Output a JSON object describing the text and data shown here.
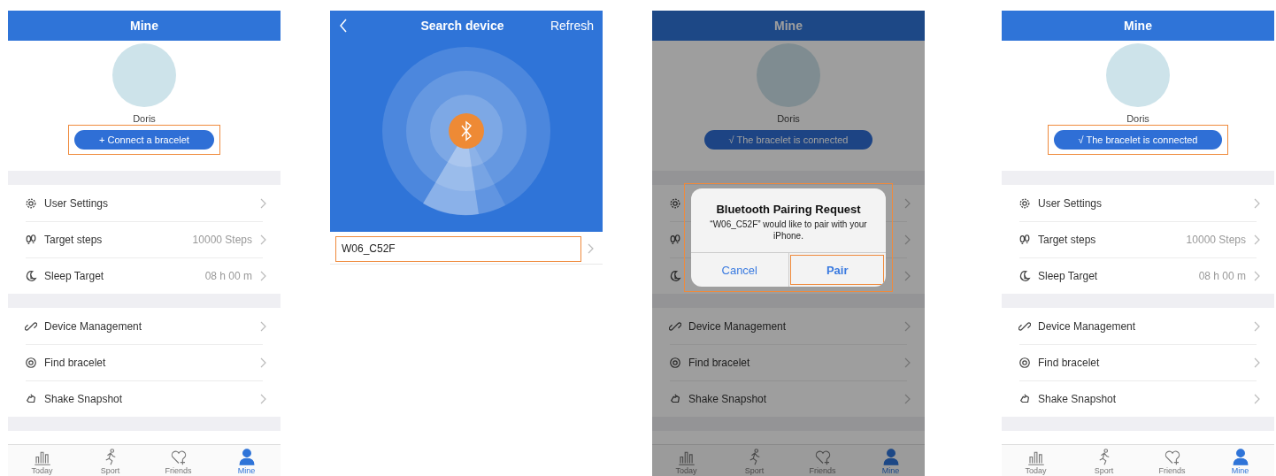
{
  "panels": [
    {
      "kind": "profile",
      "title": "Mine",
      "user_name": "Doris",
      "bracelet_button": {
        "label": "+ Connect a bracelet",
        "highlighted": true
      },
      "groups": [
        [
          {
            "kind": "setting",
            "label": "User Settings"
          },
          {
            "kind": "setting",
            "label": "Target steps",
            "value": "10000 Steps"
          },
          {
            "kind": "setting",
            "label": "Sleep Target",
            "value": "08 h 00 m"
          }
        ],
        [
          {
            "kind": "setting",
            "label": "Device Management"
          },
          {
            "kind": "setting",
            "label": "Find bracelet"
          },
          {
            "kind": "setting",
            "label": "Shake Snapshot"
          }
        ]
      ],
      "tabs": [
        {
          "label": "Today",
          "selected": false
        },
        {
          "label": "Sport",
          "selected": false
        },
        {
          "label": "Friends",
          "selected": false
        },
        {
          "label": "Mine",
          "selected": true
        }
      ]
    },
    {
      "kind": "search",
      "title": "Search device",
      "action": "Refresh",
      "devices": [
        {
          "name": "W06_C52F",
          "highlighted": true
        }
      ]
    },
    {
      "kind": "profile",
      "title": "Mine",
      "user_name": "Doris",
      "bracelet_button": {
        "label": "√ The bracelet is connected",
        "highlighted": false
      },
      "groups": [
        [
          {
            "kind": "covered"
          },
          {
            "kind": "covered"
          },
          {
            "kind": "covered"
          }
        ],
        [
          {
            "kind": "setting",
            "label": "Device Management"
          },
          {
            "kind": "setting",
            "label": "Find bracelet"
          },
          {
            "kind": "setting",
            "label": "Shake Snapshot"
          }
        ]
      ],
      "tabs": [
        {
          "label": "Today",
          "selected": false
        },
        {
          "label": "Sport",
          "selected": false
        },
        {
          "label": "Friends",
          "selected": false
        },
        {
          "label": "Mine",
          "selected": true
        }
      ],
      "dialog": {
        "title": "Bluetooth Pairing Request",
        "message": "“W06_C52F” would like to pair with your iPhone.",
        "highlighted": true,
        "buttons": [
          {
            "label": "Cancel",
            "highlighted": false
          },
          {
            "label": "Pair",
            "highlighted": true
          }
        ]
      }
    },
    {
      "kind": "profile",
      "title": "Mine",
      "user_name": "Doris",
      "bracelet_button": {
        "label": "√ The bracelet is connected",
        "highlighted": true
      },
      "groups": [
        [
          {
            "kind": "setting",
            "label": "User Settings"
          },
          {
            "kind": "setting",
            "label": "Target steps",
            "value": "10000 Steps"
          },
          {
            "kind": "setting",
            "label": "Sleep Target",
            "value": "08 h 00 m"
          }
        ],
        [
          {
            "kind": "setting",
            "label": "Device Management"
          },
          {
            "kind": "setting",
            "label": "Find bracelet"
          },
          {
            "kind": "setting",
            "label": "Shake Snapshot"
          }
        ]
      ],
      "tabs": [
        {
          "label": "Today",
          "selected": false
        },
        {
          "label": "Sport",
          "selected": false
        },
        {
          "label": "Friends",
          "selected": false
        },
        {
          "label": "Mine",
          "selected": true
        }
      ]
    }
  ]
}
